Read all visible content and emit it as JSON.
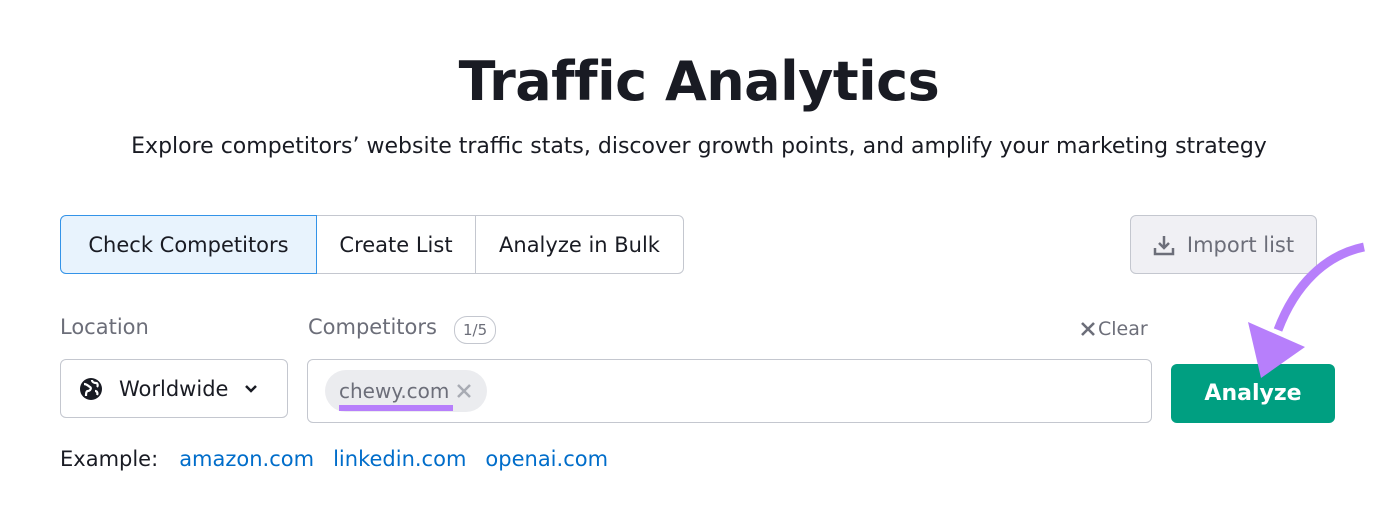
{
  "header": {
    "title": "Traffic Analytics",
    "subtitle": "Explore competitors’ website traffic stats, discover growth points, and amplify your marketing strategy"
  },
  "tabs": [
    {
      "label": "Check Competitors",
      "active": true
    },
    {
      "label": "Create List"
    },
    {
      "label": "Analyze in Bulk"
    }
  ],
  "import_label": "Import list",
  "location": {
    "label": "Location",
    "value": "Worldwide",
    "icon": "globe-icon"
  },
  "competitors": {
    "label": "Competitors",
    "count": "1/5",
    "clear_label": "Clear",
    "chips": [
      "chewy.com"
    ]
  },
  "analyze_label": "Analyze",
  "example": {
    "label": "Example:",
    "links": [
      "amazon.com",
      "linkedin.com",
      "openai.com"
    ]
  },
  "colors": {
    "accent": "#009f81",
    "annotation": "#b77ffb",
    "link": "#006dca",
    "active_tab_bg": "#e8f3fd"
  }
}
